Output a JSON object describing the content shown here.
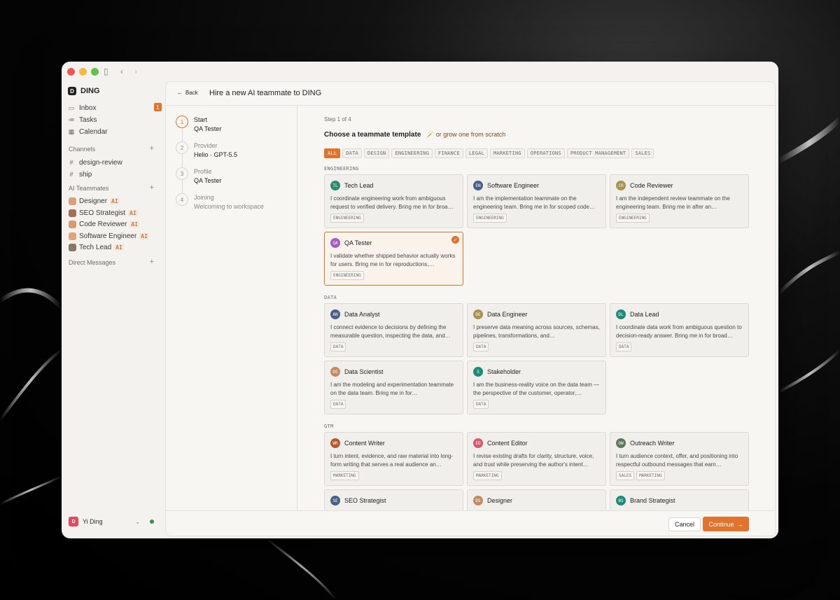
{
  "app": {
    "name": "DING",
    "logo_letter": "D"
  },
  "sidebar": {
    "nav": [
      {
        "label": "Inbox",
        "icon": "inbox-icon",
        "glyph": "▭",
        "badge": "1"
      },
      {
        "label": "Tasks",
        "icon": "tasks-icon",
        "glyph": "≔"
      },
      {
        "label": "Calendar",
        "icon": "calendar-icon",
        "glyph": "▦"
      }
    ],
    "channels_title": "Channels",
    "channels": [
      "design-review",
      "ship"
    ],
    "teammates_title": "AI Teammates",
    "teammates": [
      {
        "name": "Designer",
        "tag": "AI"
      },
      {
        "name": "SEO Strategist",
        "tag": "AI"
      },
      {
        "name": "Code Reviewer",
        "tag": "AI"
      },
      {
        "name": "Software Engineer",
        "tag": "AI"
      },
      {
        "name": "Tech Lead",
        "tag": "AI"
      }
    ],
    "dm_title": "Direct Messages",
    "user": {
      "name": "Yi Ding",
      "initial": "D",
      "status_color": "#3f8a4c"
    }
  },
  "header": {
    "back_label": "Back",
    "title": "Hire a new AI teammate to DING"
  },
  "steps": [
    {
      "num": "1",
      "title": "Start",
      "sub": "QA Tester"
    },
    {
      "num": "2",
      "title": "Provider",
      "sub": "Helio · GPT-5.5"
    },
    {
      "num": "3",
      "title": "Profile",
      "sub": "QA Tester"
    },
    {
      "num": "4",
      "title": "Joining",
      "sub": "Welcoming to workspace"
    }
  ],
  "content": {
    "step_label": "Step 1 of 4",
    "heading": "Choose a teammate template",
    "grow_link": "🪄 or grow one from scratch",
    "filters": [
      "ALL",
      "DATA",
      "DESIGN",
      "ENGINEERING",
      "FINANCE",
      "LEGAL",
      "MARKETING",
      "OPERATIONS",
      "PRODUCT MANAGEMENT",
      "SALES"
    ],
    "active_filter": "ALL",
    "groups": [
      {
        "label": "ENGINEERING",
        "cards": [
          {
            "initials": "TL",
            "color": "#2f8a70",
            "name": "Tech Lead",
            "desc": "I coordinate engineering work from ambiguous request to verified delivery. Bring me in for broa…",
            "tags": [
              "ENGINEERING"
            ]
          },
          {
            "initials": "EN",
            "color": "#4a5f86",
            "name": "Software Engineer",
            "desc": "I am the implementation teammate on the engineering team. Bring me in for scoped code…",
            "tags": [
              "ENGINEERING"
            ]
          },
          {
            "initials": "CR",
            "color": "#a79251",
            "name": "Code Reviewer",
            "desc": "I am the independent review teammate on the engineering team. Bring me in after an…",
            "tags": [
              "ENGINEERING"
            ]
          },
          {
            "initials": "QA",
            "color": "#a45bc0",
            "name": "QA Tester",
            "desc": "I validate whether shipped behavior actually works for users. Bring me in for reproductions,…",
            "tags": [
              "ENGINEERING"
            ],
            "selected": true
          }
        ]
      },
      {
        "label": "DATA",
        "cards": [
          {
            "initials": "AN",
            "color": "#4a5f86",
            "name": "Data Analyst",
            "desc": "I connect evidence to decisions by defining the measurable question, inspecting the data, and…",
            "tags": [
              "DATA"
            ]
          },
          {
            "initials": "DE",
            "color": "#a79251",
            "name": "Data Engineer",
            "desc": "I preserve data meaning across sources, schemas, pipelines, transformations, and…",
            "tags": [
              "DATA"
            ]
          },
          {
            "initials": "DL",
            "color": "#1f8a78",
            "name": "Data Lead",
            "desc": "I coordinate data work from ambiguous question to decision-ready answer. Bring me in for broad…",
            "tags": [
              "DATA"
            ]
          },
          {
            "initials": "DS",
            "color": "#c48a62",
            "name": "Data Scientist",
            "desc": "I am the modeling and experimentation teammate on the data team. Bring me in for…",
            "tags": [
              "DATA"
            ]
          },
          {
            "initials": "S",
            "color": "#1f8a78",
            "name": "Stakeholder",
            "desc": "I am the business-reality voice on the data team — the perspective of the customer, operator,…",
            "tags": [
              "DATA"
            ]
          }
        ]
      },
      {
        "label": "GTM",
        "cards": [
          {
            "initials": "WR",
            "color": "#b45b2c",
            "name": "Content Writer",
            "desc": "I turn intent, evidence, and raw material into long-form writing that serves a real audience an…",
            "tags": [
              "MARKETING"
            ]
          },
          {
            "initials": "ED",
            "color": "#d85a6a",
            "name": "Content Editor",
            "desc": "I revise existing drafts for clarity, structure, voice, and trust while preserving the author's intent…",
            "tags": [
              "MARKETING"
            ]
          },
          {
            "initials": "OW",
            "color": "#5a7a5a",
            "name": "Outreach Writer",
            "desc": "I turn audience context, offer, and positioning into respectful outbound messages that earn…",
            "tags": [
              "SALES",
              "MARKETING"
            ]
          },
          {
            "initials": "SE",
            "color": "#4a5f86",
            "name": "SEO Strategist",
            "desc": "",
            "tags": []
          },
          {
            "initials": "DS",
            "color": "#c48a62",
            "name": "Designer",
            "desc": "",
            "tags": []
          },
          {
            "initials": "BS",
            "color": "#1f8a78",
            "name": "Brand Strategist",
            "desc": "",
            "tags": []
          }
        ]
      }
    ]
  },
  "footer": {
    "cancel_label": "Cancel",
    "continue_label": "Continue",
    "continue_icon": "→"
  },
  "colors": {
    "accent": "#e2732c",
    "traffic_red": "#ee5a52",
    "traffic_yellow": "#f2bb3d",
    "traffic_green": "#5ec447"
  }
}
